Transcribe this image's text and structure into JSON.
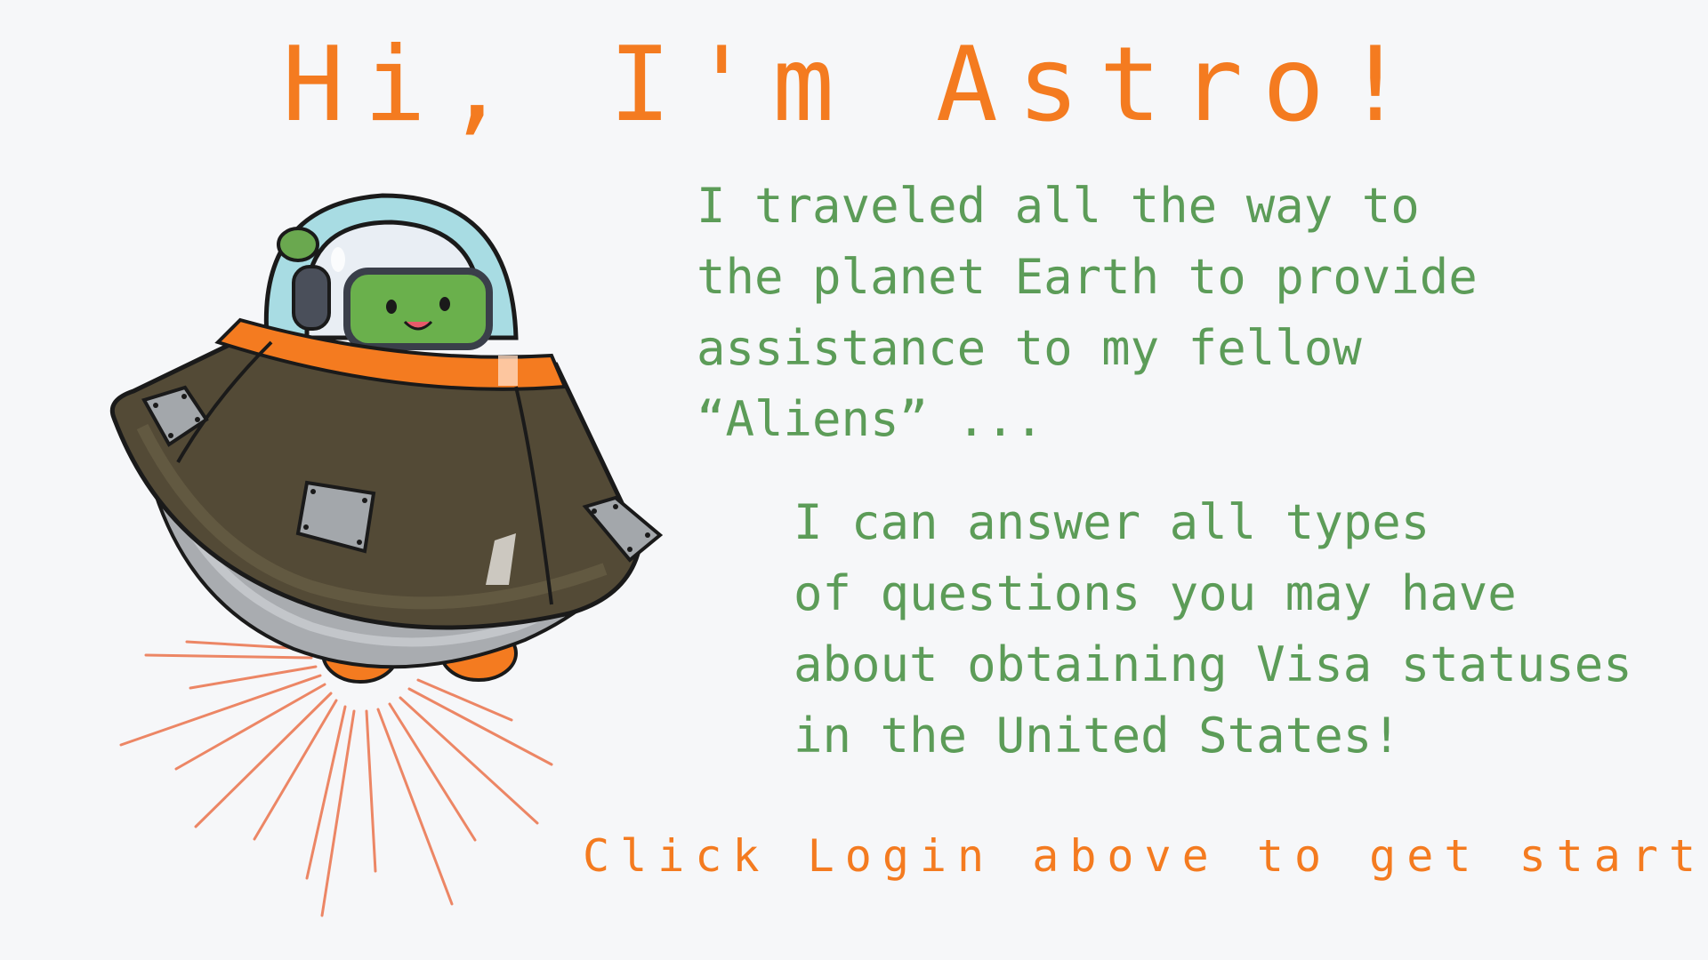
{
  "title": "Hi, I'm Astro!",
  "intro": {
    "lines": [
      "I traveled all the way to",
      "the planet Earth to provide",
      "assistance to my fellow",
      "“Aliens” ..."
    ]
  },
  "info": {
    "lines": [
      "I can answer all types",
      "of questions you may have",
      "about obtaining Visa statuses",
      "in the United States!"
    ]
  },
  "cta": "Click Login above to get started",
  "colors": {
    "accent": "#f47b20",
    "text_green": "#5c9c58",
    "background": "#f6f7f9"
  },
  "illustration": {
    "name": "astro-ufo-illustration"
  }
}
